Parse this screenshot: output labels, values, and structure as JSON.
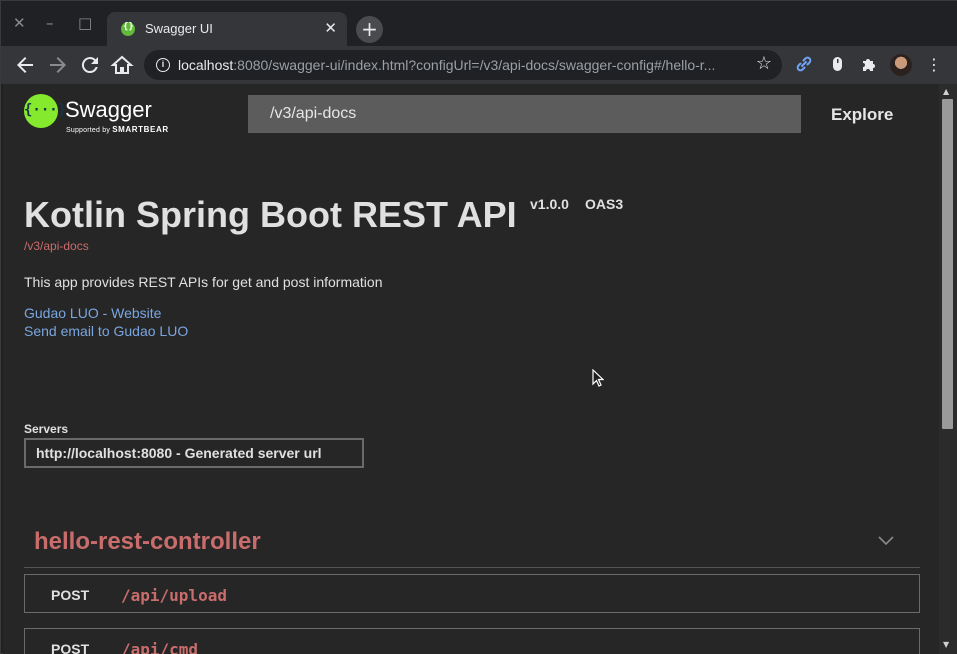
{
  "browser": {
    "window_controls": {
      "close": "✕",
      "minimize": "–",
      "maximize": "□"
    },
    "tab": {
      "title": "Swagger UI",
      "close": "✕"
    },
    "new_tab": "+",
    "url": {
      "host": "localhost",
      "rest": ":8080/swagger-ui/index.html?configUrl=/v3/api-docs/swagger-config#/hello-r..."
    }
  },
  "swagger": {
    "logo_text": "Swagger",
    "logo_sub_prefix": "Supported by",
    "logo_sub_brand": "SMARTBEAR",
    "logo_symbol": "{···}",
    "search_value": "/v3/api-docs",
    "explore_label": "Explore",
    "info": {
      "title": "Kotlin Spring Boot REST API",
      "version": "v1.0.0",
      "oas": "OAS3",
      "url": "/v3/api-docs",
      "description": "This app provides REST APIs for get and post information",
      "links": [
        "Gudao LUO - Website",
        "Send email to Gudao LUO"
      ]
    },
    "servers": {
      "label": "Servers",
      "selected": "http://localhost:8080 - Generated server url"
    },
    "section": {
      "title": "hello-rest-controller",
      "operations": [
        {
          "method": "POST",
          "path": "/api/upload"
        },
        {
          "method": "POST",
          "path": "/api/cmd"
        }
      ]
    }
  },
  "colors": {
    "accent_link": "#7aa6e0",
    "path_red": "#c96c6c",
    "swagger_green": "#85ea2d"
  }
}
